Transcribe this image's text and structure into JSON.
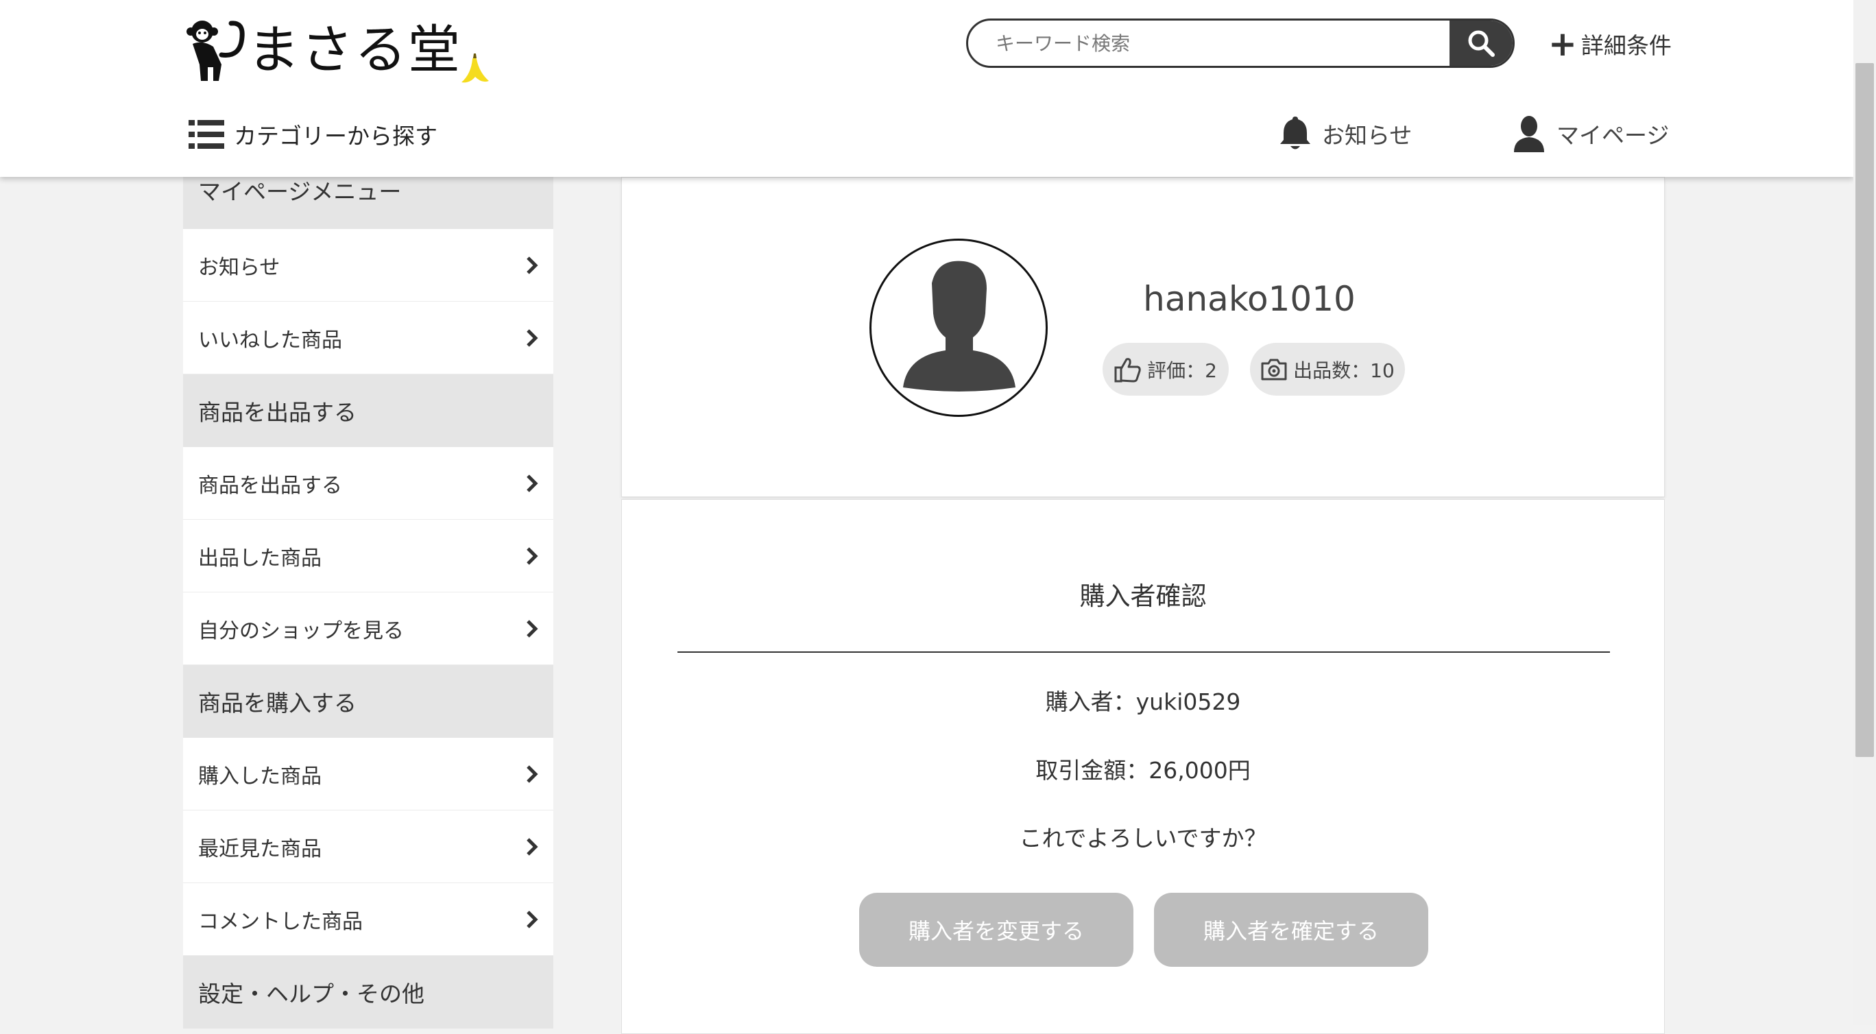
{
  "header": {
    "logo_text": "まさる堂",
    "search": {
      "placeholder": "キーワード検索",
      "value": ""
    },
    "detail_label": "詳細条件",
    "category_label": "カテゴリーから探す",
    "notify_label": "お知らせ",
    "mypage_label": "マイページ"
  },
  "sidebar": {
    "sections": [
      {
        "title": "マイページメニュー",
        "items": [
          "お知らせ",
          "いいねした商品"
        ]
      },
      {
        "title": "商品を出品する",
        "items": [
          "商品を出品する",
          "出品した商品",
          "自分のショップを見る"
        ]
      },
      {
        "title": "商品を購入する",
        "items": [
          "購入した商品",
          "最近見た商品",
          "コメントした商品"
        ]
      },
      {
        "title": "設定・ヘルプ・その他",
        "items": []
      }
    ]
  },
  "profile": {
    "username": "hanako1010",
    "rating_label": "評価：2",
    "listing_label": "出品数：10"
  },
  "confirm": {
    "title": "購入者確認",
    "buyer": "購入者：yuki0529",
    "amount": "取引金額：26,000円",
    "question": "これでよろしいですか？",
    "change_button": "購入者を変更する",
    "confirm_button": "購入者を確定する"
  },
  "colors": {
    "button_gray": "#bdbdbd",
    "sidebar_head": "#e5e5e5",
    "banana_yellow": "#f5dc1f"
  }
}
